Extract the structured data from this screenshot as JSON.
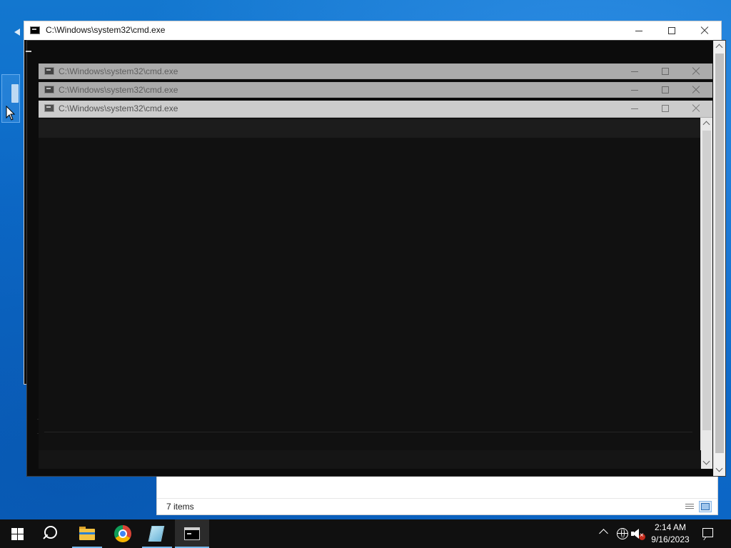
{
  "explorer": {
    "status_items": "7 items"
  },
  "windows": {
    "main": {
      "title": "C:\\Windows\\system32\\cmd.exe"
    },
    "ghost1": {
      "title": "C:\\Windows\\system32\\cmd.exe"
    },
    "ghost2": {
      "title": "C:\\Windows\\system32\\cmd.exe"
    },
    "front": {
      "title": "C:\\Windows\\system32\\cmd.exe"
    }
  },
  "taskbar": {
    "items": [
      "start",
      "search",
      "file-explorer",
      "chrome",
      "notepad",
      "command-prompt"
    ],
    "active": "command-prompt",
    "clock": {
      "time": "2:14 AM",
      "date": "9/16/2023"
    }
  },
  "colors": {
    "desktop": "#0c66c5",
    "taskbar": "#101010",
    "console_bg": "#0c0c0c",
    "accent": "#76b9ed"
  },
  "icons": [
    "windows-logo",
    "search-icon",
    "folder-icon",
    "chrome-icon",
    "notepad-icon",
    "terminal-icon",
    "chevron-up-icon",
    "globe-icon",
    "speaker-muted-icon",
    "notification-icon"
  ]
}
